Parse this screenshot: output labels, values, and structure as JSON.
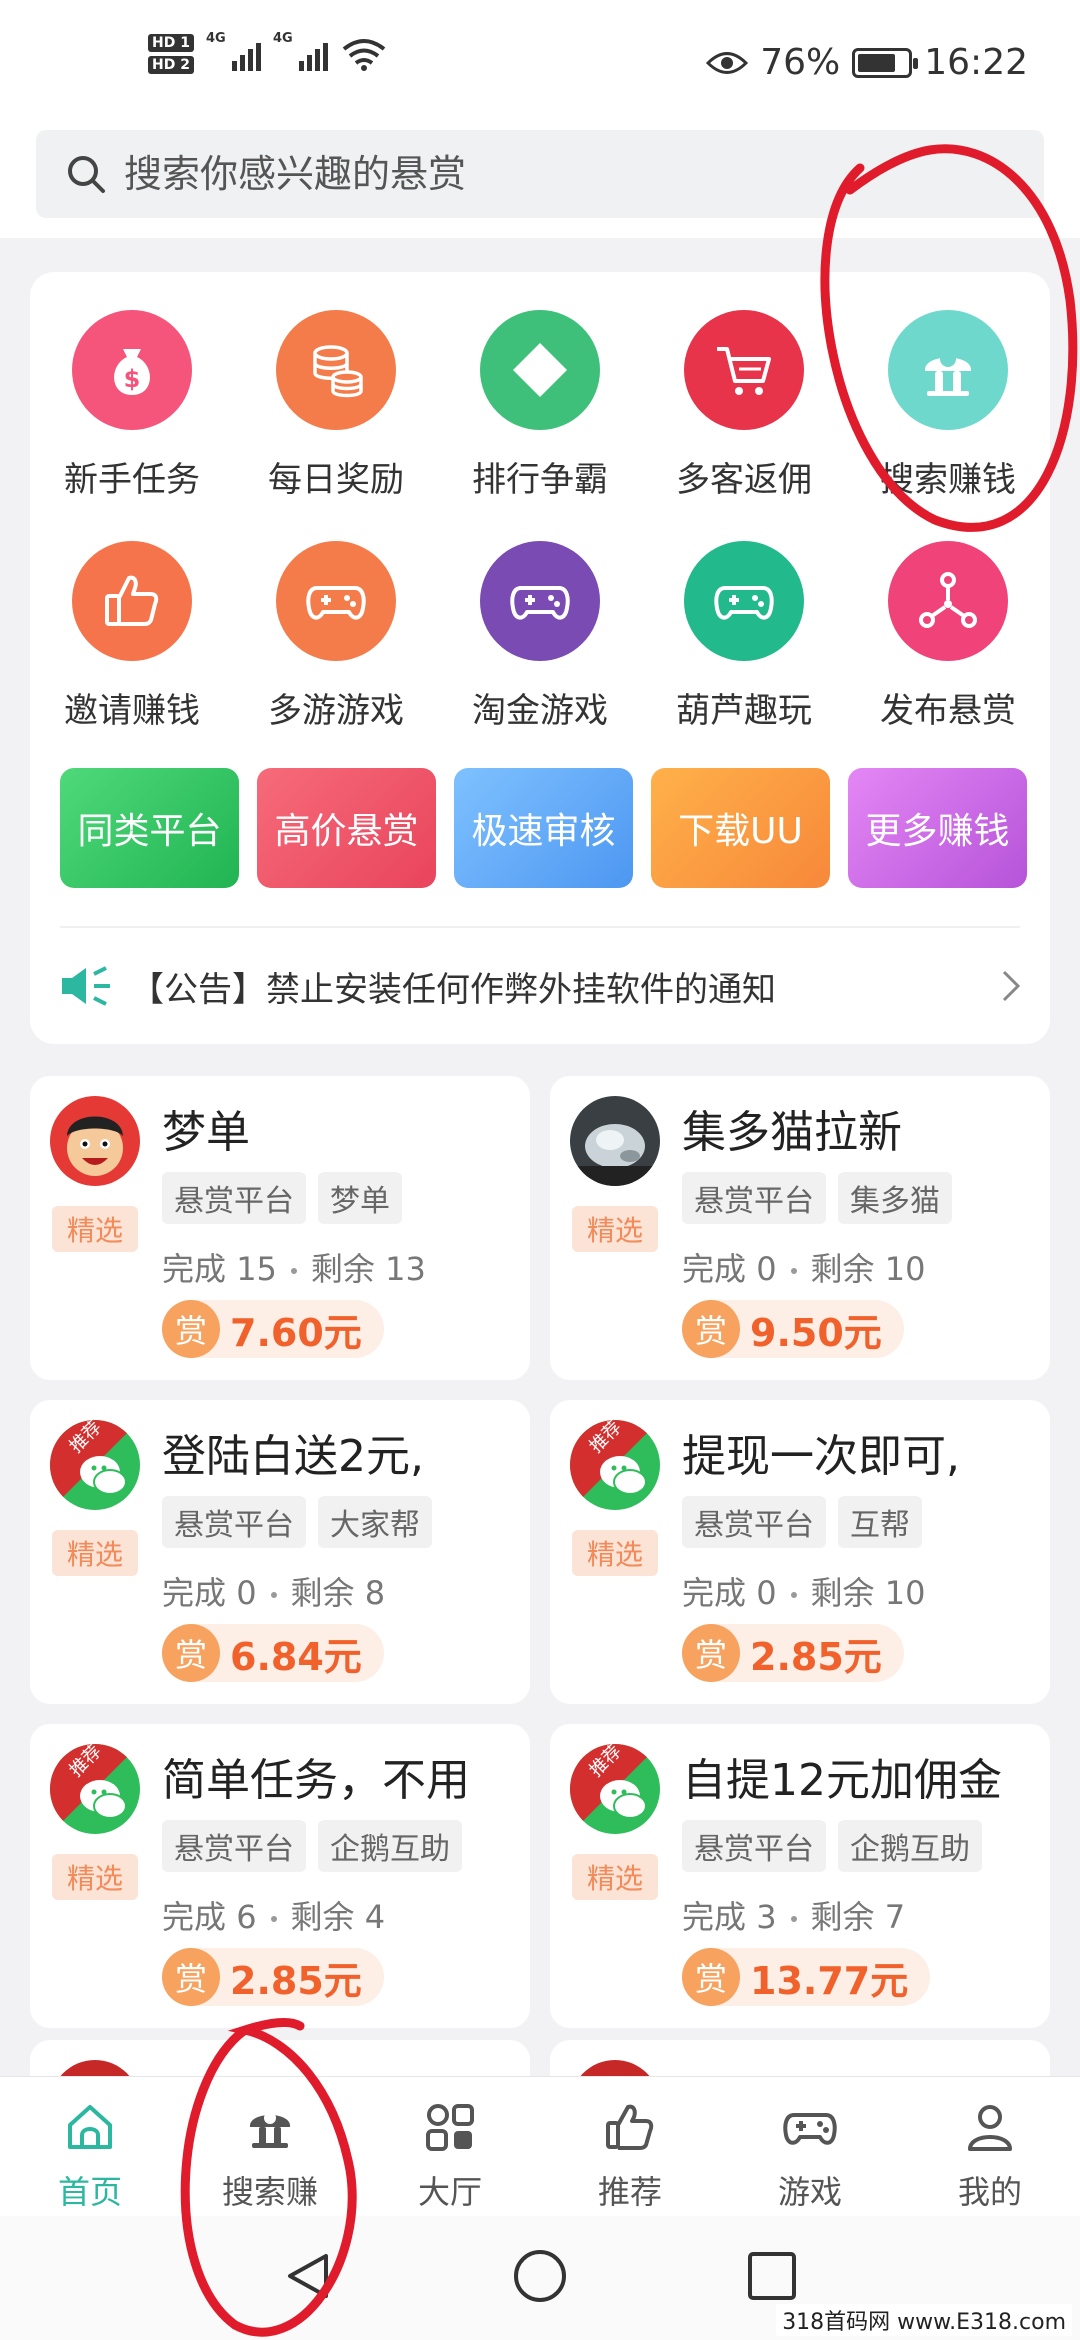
{
  "status_bar": {
    "hd1": "HD 1",
    "hd2": "HD 2",
    "sig1": "4G",
    "sig2": "4G",
    "battery_percent": "76%",
    "time": "16:22",
    "battery_level": 0.76
  },
  "search": {
    "placeholder": "搜索你感兴趣的悬赏"
  },
  "grid": [
    {
      "label": "新手任务",
      "icon": "money-bag-icon",
      "color": "#f5547b"
    },
    {
      "label": "每日奖励",
      "icon": "coins-icon",
      "color": "#f47c4a"
    },
    {
      "label": "排行争霸",
      "icon": "diamond-icon",
      "color": "#3fc07a"
    },
    {
      "label": "多客返佣",
      "icon": "cart-icon",
      "color": "#e8344a"
    },
    {
      "label": "搜索赚钱",
      "icon": "search-earn-icon",
      "color": "#6fd8cc"
    },
    {
      "label": "邀请赚钱",
      "icon": "thumbs-up-icon",
      "color": "#f6744b"
    },
    {
      "label": "多游游戏",
      "icon": "gamepad-icon",
      "color": "#f47c4a"
    },
    {
      "label": "淘金游戏",
      "icon": "gamepad-icon",
      "color": "#7a4bb2"
    },
    {
      "label": "葫芦趣玩",
      "icon": "gamepad-icon",
      "color": "#22b98d"
    },
    {
      "label": "发布悬赏",
      "icon": "share-nodes-icon",
      "color": "#f0437a"
    }
  ],
  "quick_links": [
    {
      "label": "同类平台",
      "from": "#4fd97a",
      "to": "#21b452"
    },
    {
      "label": "高价悬赏",
      "from": "#f66b7a",
      "to": "#e9445c"
    },
    {
      "label": "极速审核",
      "from": "#7fc1ff",
      "to": "#4d97f1"
    },
    {
      "label": "下载UU",
      "from": "#ffb14a",
      "to": "#f7883a"
    },
    {
      "label": "更多赚钱",
      "from": "#e487f5",
      "to": "#b653d9"
    }
  ],
  "notice": {
    "text": "【公告】禁止安装任何作弊外挂软件的通知"
  },
  "tasks": [
    {
      "title": "梦单",
      "badge": "精选",
      "tags": [
        "悬赏平台",
        "梦单"
      ],
      "completed_label": "完成",
      "completed": "15",
      "remaining_label": "剩余",
      "remaining": "13",
      "reward_icon": "赏",
      "reward": "7.60元",
      "avatar": "cartoon"
    },
    {
      "title": "集多猫拉新",
      "badge": "精选",
      "tags": [
        "悬赏平台",
        "集多猫"
      ],
      "completed_label": "完成",
      "completed": "0",
      "remaining_label": "剩余",
      "remaining": "10",
      "reward_icon": "赏",
      "reward": "9.50元",
      "avatar": "photo"
    },
    {
      "title": "登陆白送2元,",
      "badge": "精选",
      "tags": [
        "悬赏平台",
        "大家帮"
      ],
      "completed_label": "完成",
      "completed": "0",
      "remaining_label": "剩余",
      "remaining": "8",
      "reward_icon": "赏",
      "reward": "6.84元",
      "avatar": "wechat",
      "ribbon": "推荐"
    },
    {
      "title": "提现一次即可,",
      "badge": "精选",
      "tags": [
        "悬赏平台",
        "互帮"
      ],
      "completed_label": "完成",
      "completed": "0",
      "remaining_label": "剩余",
      "remaining": "10",
      "reward_icon": "赏",
      "reward": "2.85元",
      "avatar": "wechat",
      "ribbon": "推荐"
    },
    {
      "title": "简单任务，不用",
      "badge": "精选",
      "tags": [
        "悬赏平台",
        "企鹅互助"
      ],
      "completed_label": "完成",
      "completed": "6",
      "remaining_label": "剩余",
      "remaining": "4",
      "reward_icon": "赏",
      "reward": "2.85元",
      "avatar": "wechat",
      "ribbon": "推荐"
    },
    {
      "title": "自提12元加佣金",
      "badge": "精选",
      "tags": [
        "悬赏平台",
        "企鹅互助"
      ],
      "completed_label": "完成",
      "completed": "3",
      "remaining_label": "剩余",
      "remaining": "7",
      "reward_icon": "赏",
      "reward": "13.77元",
      "avatar": "wechat",
      "ribbon": "推荐"
    }
  ],
  "bottom_nav": [
    {
      "label": "首页",
      "icon": "home-icon",
      "active": true
    },
    {
      "label": "搜索赚",
      "icon": "search-earn-icon",
      "active": false
    },
    {
      "label": "大厅",
      "icon": "hall-icon",
      "active": false
    },
    {
      "label": "推荐",
      "icon": "thumbs-up-icon",
      "active": false
    },
    {
      "label": "游戏",
      "icon": "gamepad-icon",
      "active": false
    },
    {
      "label": "我的",
      "icon": "profile-icon",
      "active": false
    }
  ],
  "watermark": "318首码网 www.E318.com"
}
